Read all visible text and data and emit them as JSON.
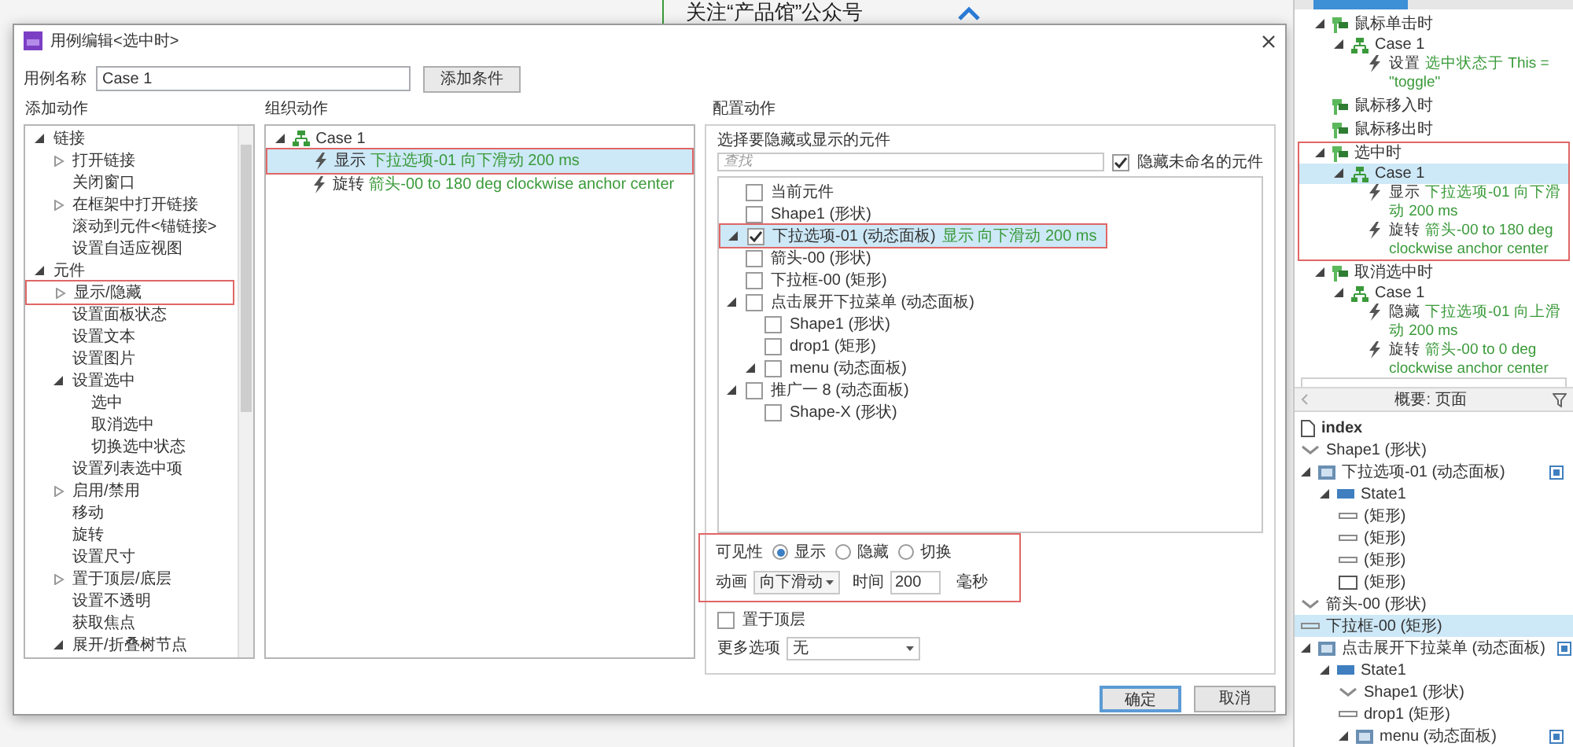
{
  "canvas": {
    "heading": "关注“产品馆”公众号"
  },
  "dialog": {
    "title": "用例编辑<选中时>",
    "case_name_label": "用例名称",
    "case_name": "Case 1",
    "add_condition": "添加条件",
    "add_actions": {
      "label": "添加动作",
      "items": [
        {
          "label": "链接",
          "expanded": true,
          "highlighted": false,
          "children": [
            {
              "label": "打开链接",
              "expanded": false,
              "highlighted": false
            },
            {
              "label": "关闭窗口",
              "highlighted": false
            },
            {
              "label": "在框架中打开链接",
              "expanded": false,
              "highlighted": false
            },
            {
              "label": "滚动到元件<锚链接>",
              "highlighted": false
            },
            {
              "label": "设置自适应视图",
              "highlighted": false
            }
          ]
        },
        {
          "label": "元件",
          "expanded": true,
          "highlighted": false,
          "children": [
            {
              "label": "显示/隐藏",
              "expanded": false,
              "highlighted": true
            },
            {
              "label": "设置面板状态",
              "highlighted": false
            },
            {
              "label": "设置文本",
              "highlighted": false
            },
            {
              "label": "设置图片",
              "highlighted": false
            },
            {
              "label": "设置选中",
              "expanded": true,
              "highlighted": false,
              "children": [
                {
                  "label": "选中",
                  "highlighted": false
                },
                {
                  "label": "取消选中",
                  "highlighted": false
                },
                {
                  "label": "切换选中状态",
                  "highlighted": false
                }
              ]
            },
            {
              "label": "设置列表选中项",
              "highlighted": false
            },
            {
              "label": "启用/禁用",
              "expanded": false,
              "highlighted": false
            },
            {
              "label": "移动",
              "highlighted": false
            },
            {
              "label": "旋转",
              "highlighted": false
            },
            {
              "label": "设置尺寸",
              "highlighted": false
            },
            {
              "label": "置于顶层/底层",
              "expanded": false,
              "highlighted": false
            },
            {
              "label": "设置不透明",
              "highlighted": false
            },
            {
              "label": "获取焦点",
              "highlighted": false
            },
            {
              "label": "展开/折叠树节点",
              "expanded": true,
              "highlighted": false
            }
          ]
        }
      ]
    },
    "organize": {
      "label": "组织动作",
      "case": {
        "label": "Case 1",
        "expanded": true,
        "actions": [
          {
            "verb": "显示",
            "detail": "下拉选项-01 向下滑动 200 ms",
            "selected": true,
            "highlighted": true
          },
          {
            "verb": "旋转",
            "detail": "箭头-00 to 180 deg clockwise anchor center",
            "selected": false,
            "highlighted": false
          }
        ]
      }
    },
    "configure": {
      "label": "配置动作",
      "prompt": "选择要隐藏或显示的元件",
      "search_placeholder": "查找",
      "hide_unnamed": {
        "label": "隐藏未命名的元件",
        "checked": true
      },
      "widgets": [
        {
          "label": "当前元件",
          "checked": false,
          "selected": false,
          "highlighted": false
        },
        {
          "label": "Shape1 (形状)",
          "checked": false,
          "selected": false,
          "highlighted": false
        },
        {
          "label": "下拉选项-01 (动态面板)",
          "note": "显示 向下滑动 200 ms",
          "expanded": true,
          "checked": true,
          "selected": true,
          "highlighted": true
        },
        {
          "label": "箭头-00 (形状)",
          "checked": false,
          "selected": false,
          "highlighted": false
        },
        {
          "label": "下拉框-00 (矩形)",
          "checked": false,
          "selected": false,
          "highlighted": false
        },
        {
          "label": "点击展开下拉菜单 (动态面板)",
          "expanded": true,
          "checked": false,
          "selected": false,
          "highlighted": false,
          "children": [
            {
              "label": "Shape1 (形状)",
              "checked": false,
              "selected": false,
              "highlighted": false
            },
            {
              "label": "drop1 (矩形)",
              "checked": false,
              "selected": false,
              "highlighted": false
            },
            {
              "label": "menu (动态面板)",
              "expanded": true,
              "checked": false,
              "selected": false,
              "highlighted": false
            }
          ]
        },
        {
          "label": "推广一 8 (动态面板)",
          "expanded": true,
          "checked": false,
          "selected": false,
          "highlighted": false,
          "children": [
            {
              "label": "Shape-X (形状)",
              "checked": false,
              "selected": false,
              "highlighted": false
            }
          ]
        }
      ],
      "visibility": {
        "label": "可见性",
        "highlighted": true,
        "options": [
          {
            "label": "显示",
            "selected": true
          },
          {
            "label": "隐藏",
            "selected": false
          },
          {
            "label": "切换",
            "selected": false
          }
        ],
        "animation_label": "动画",
        "animation": "向下滑动",
        "time_label": "时间",
        "time": "200",
        "unit": "毫秒"
      },
      "bring_to_front": {
        "label": "置于顶层",
        "checked": false
      },
      "more_options": {
        "label": "更多选项",
        "value": "无"
      }
    },
    "buttons": [
      "确定",
      "取消"
    ]
  },
  "interactions": {
    "events": [
      {
        "label": "鼠标单击时",
        "expanded": true,
        "highlighted": false,
        "cases": [
          {
            "label": "Case 1",
            "expanded": true,
            "selected": false,
            "actions": [
              {
                "verb": "设置",
                "detail": "选中状态于 This = \"toggle\""
              }
            ]
          }
        ]
      },
      {
        "label": "鼠标移入时",
        "highlighted": false
      },
      {
        "label": "鼠标移出时",
        "highlighted": false
      },
      {
        "label": "选中时",
        "expanded": true,
        "highlighted": true,
        "cases": [
          {
            "label": "Case 1",
            "expanded": true,
            "selected": true,
            "actions": [
              {
                "verb": "显示",
                "detail": "下拉选项-01 向下滑动 200 ms"
              },
              {
                "verb": "旋转",
                "detail": "箭头-00 to 180 deg clockwise anchor center"
              }
            ]
          }
        ]
      },
      {
        "label": "取消选中时",
        "expanded": true,
        "highlighted": false,
        "cases": [
          {
            "label": "Case 1",
            "expanded": true,
            "selected": false,
            "actions": [
              {
                "verb": "隐藏",
                "detail": "下拉选项-01 向上滑动 200 ms"
              },
              {
                "verb": "旋转",
                "detail": "箭头-00 to 0 deg clockwise anchor center"
              }
            ]
          }
        ]
      }
    ]
  },
  "outline": {
    "title": "概要: 页面",
    "items": [
      {
        "label": "index",
        "kind": "page",
        "selected": false
      },
      {
        "label": "Shape1 (形状)",
        "kind": "shape",
        "selected": false
      },
      {
        "label": "下拉选项-01 (动态面板)",
        "kind": "panel",
        "expanded": true,
        "selected": false,
        "children": [
          {
            "label": "State1",
            "kind": "state",
            "expanded": true,
            "selected": false,
            "children": [
              {
                "label": "(矩形)",
                "kind": "line",
                "selected": false
              },
              {
                "label": "(矩形)",
                "kind": "line",
                "selected": false
              },
              {
                "label": "(矩形)",
                "kind": "line",
                "selected": false
              },
              {
                "label": "(矩形)",
                "kind": "rect",
                "selected": false
              }
            ]
          }
        ]
      },
      {
        "label": "箭头-00 (形状)",
        "kind": "shape",
        "selected": false
      },
      {
        "label": "下拉框-00 (矩形)",
        "kind": "line",
        "selected": true
      },
      {
        "label": "点击展开下拉菜单 (动态面板)",
        "kind": "panel",
        "expanded": true,
        "selected": false,
        "children": [
          {
            "label": "State1",
            "kind": "state",
            "expanded": true,
            "selected": false,
            "children": [
              {
                "label": "Shape1 (形状)",
                "kind": "shape",
                "selected": false
              },
              {
                "label": "drop1 (矩形)",
                "kind": "line",
                "selected": false
              },
              {
                "label": "menu (动态面板)",
                "kind": "panel",
                "expanded": true,
                "selected": false
              }
            ]
          }
        ]
      }
    ]
  }
}
